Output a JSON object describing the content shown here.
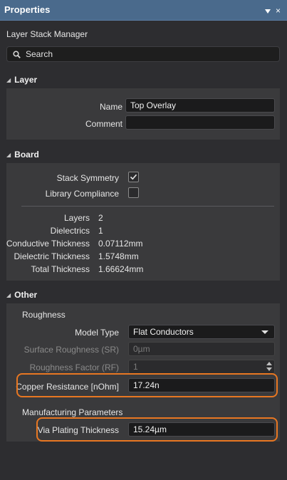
{
  "window": {
    "title": "Properties",
    "pin_icon": "pin-icon",
    "close_glyph": "×"
  },
  "subtitle": "Layer Stack Manager",
  "search": {
    "placeholder": "Search",
    "icon": "search-icon"
  },
  "layer_section": {
    "heading": "Layer",
    "name_label": "Name",
    "name_value": "Top Overlay",
    "comment_label": "Comment",
    "comment_value": ""
  },
  "board_section": {
    "heading": "Board",
    "stack_symmetry_label": "Stack Symmetry",
    "stack_symmetry_checked": true,
    "library_compliance_label": "Library Compliance",
    "library_compliance_checked": false,
    "stats": [
      {
        "label": "Layers",
        "value": "2"
      },
      {
        "label": "Dielectrics",
        "value": "1"
      },
      {
        "label": "Conductive Thickness",
        "value": "0.07112mm"
      },
      {
        "label": "Dielectric Thickness",
        "value": "1.5748mm"
      },
      {
        "label": "Total Thickness",
        "value": "1.66624mm"
      }
    ]
  },
  "other_section": {
    "heading": "Other",
    "roughness_heading": "Roughness",
    "model_type_label": "Model Type",
    "model_type_value": "Flat Conductors",
    "surface_roughness_label": "Surface Roughness (SR)",
    "surface_roughness_value": "0µm",
    "roughness_factor_label": "Roughness Factor (RF)",
    "roughness_factor_value": "1",
    "copper_resistance_label": "Copper Resistance [nOhm]",
    "copper_resistance_value": "17.24n",
    "manufacturing_heading": "Manufacturing Parameters",
    "via_plating_label": "Via Plating Thickness",
    "via_plating_value": "15.24µm"
  },
  "colors": {
    "titlebar": "#4a6a8c",
    "highlight": "#e87722",
    "panel": "#3a3a3c",
    "background": "#2d2d30"
  }
}
